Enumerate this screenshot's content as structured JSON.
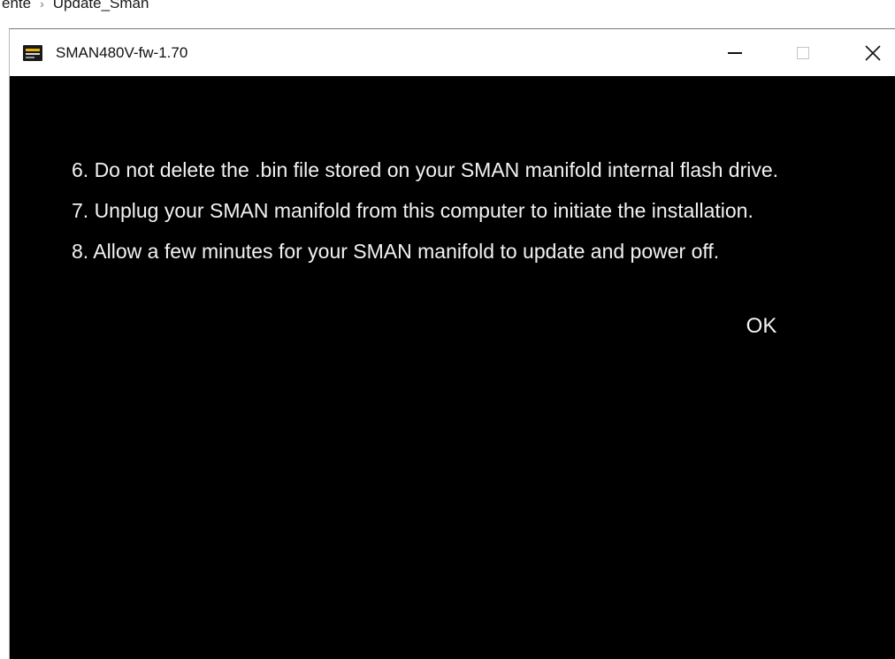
{
  "explorer": {
    "breadcrumb": [
      "ente",
      "Update_Sman"
    ]
  },
  "window": {
    "title": "SMAN480V-fw-1.70",
    "controls": {
      "minimize": "minimize-icon",
      "maximize": "maximize-icon",
      "close": "close-icon"
    }
  },
  "content": {
    "instructions": [
      "6. Do not delete the .bin file stored on your SMAN manifold internal flash drive.",
      "7. Unplug your SMAN manifold from this computer to initiate the installation.",
      "8. Allow a few minutes for your SMAN manifold to update and power off."
    ],
    "ok_label": "OK"
  },
  "colors": {
    "content_background": "#000000",
    "content_text": "#f2f2f2",
    "titlebar_background": "#ffffff",
    "icon_accent": "#e8b400"
  }
}
